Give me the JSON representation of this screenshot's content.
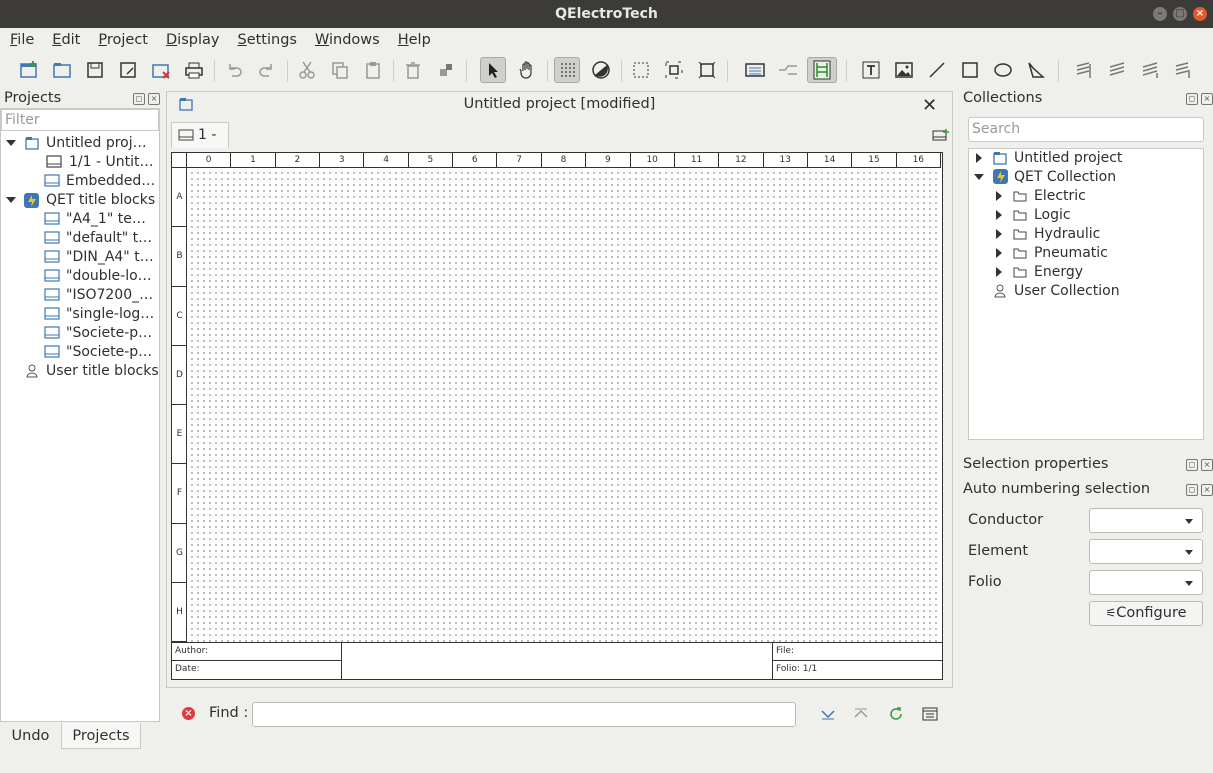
{
  "window": {
    "title": "QElectroTech"
  },
  "menu": [
    "File",
    "Edit",
    "Project",
    "Display",
    "Settings",
    "Windows",
    "Help"
  ],
  "projects_panel": {
    "title": "Projects",
    "filter_placeholder": "Filter",
    "tree": [
      {
        "label": "Untitled proj…",
        "level": 0,
        "expanded": true,
        "icon": "project-icon"
      },
      {
        "label": "1/1 - Untit…",
        "level": 1,
        "icon": "folio-icon"
      },
      {
        "label": "Embedded…",
        "level": 1,
        "icon": "titleblock-icon"
      },
      {
        "label": "QET title blocks",
        "level": 0,
        "expanded": true,
        "icon": "qet-icon"
      },
      {
        "label": "\"A4_1\" te…",
        "level": 1,
        "icon": "titleblock-icon"
      },
      {
        "label": "\"default\" t…",
        "level": 1,
        "icon": "titleblock-icon"
      },
      {
        "label": "\"DIN_A4\" t…",
        "level": 1,
        "icon": "titleblock-icon"
      },
      {
        "label": "\"double-lo…",
        "level": 1,
        "icon": "titleblock-icon"
      },
      {
        "label": "\"ISO7200_…",
        "level": 1,
        "icon": "titleblock-icon"
      },
      {
        "label": "\"single-log…",
        "level": 1,
        "icon": "titleblock-icon"
      },
      {
        "label": "\"Societe-p…",
        "level": 1,
        "icon": "titleblock-icon"
      },
      {
        "label": "\"Societe-p…",
        "level": 1,
        "icon": "titleblock-icon"
      },
      {
        "label": "User title blocks",
        "level": 0,
        "icon": "user-icon"
      }
    ],
    "tabs": [
      "Undo",
      "Projects"
    ]
  },
  "document": {
    "title": "Untitled project [modified]",
    "tab_label": "1 -",
    "columns": [
      "0",
      "1",
      "2",
      "3",
      "4",
      "5",
      "6",
      "7",
      "8",
      "9",
      "10",
      "11",
      "12",
      "13",
      "14",
      "15",
      "16"
    ],
    "rows": [
      "A",
      "B",
      "C",
      "D",
      "E",
      "F",
      "G",
      "H"
    ],
    "titleblock": {
      "author": "Author:",
      "date": "Date:",
      "file": "File:",
      "folio": "Folio: 1/1"
    }
  },
  "find_bar": {
    "label": "Find :",
    "value": ""
  },
  "collections": {
    "title": "Collections",
    "search_placeholder": "Search",
    "tree": [
      {
        "label": "Untitled project",
        "level": 0,
        "arrow": "right",
        "icon": "project-icon"
      },
      {
        "label": "QET Collection",
        "level": 0,
        "arrow": "down",
        "icon": "qet-icon"
      },
      {
        "label": "Electric",
        "level": 1,
        "arrow": "right",
        "icon": "folder-icon"
      },
      {
        "label": "Logic",
        "level": 1,
        "arrow": "right",
        "icon": "folder-icon"
      },
      {
        "label": "Hydraulic",
        "level": 1,
        "arrow": "right",
        "icon": "folder-icon"
      },
      {
        "label": "Pneumatic",
        "level": 1,
        "arrow": "right",
        "icon": "folder-icon"
      },
      {
        "label": "Energy",
        "level": 1,
        "arrow": "right",
        "icon": "folder-icon"
      },
      {
        "label": "User Collection",
        "level": 0,
        "arrow": "none",
        "icon": "user-icon"
      }
    ]
  },
  "selection_properties": {
    "title": "Selection properties"
  },
  "auto_numbering": {
    "title": "Auto numbering selection",
    "fields": [
      {
        "label": "Conductor",
        "value": ""
      },
      {
        "label": "Element",
        "value": ""
      },
      {
        "label": "Folio",
        "value": ""
      }
    ],
    "configure_label": "Configure"
  },
  "colors": {
    "accent_blue": "#3f77b5",
    "qet_yellow": "#e9c624",
    "titlebar": "#3c3b37"
  }
}
